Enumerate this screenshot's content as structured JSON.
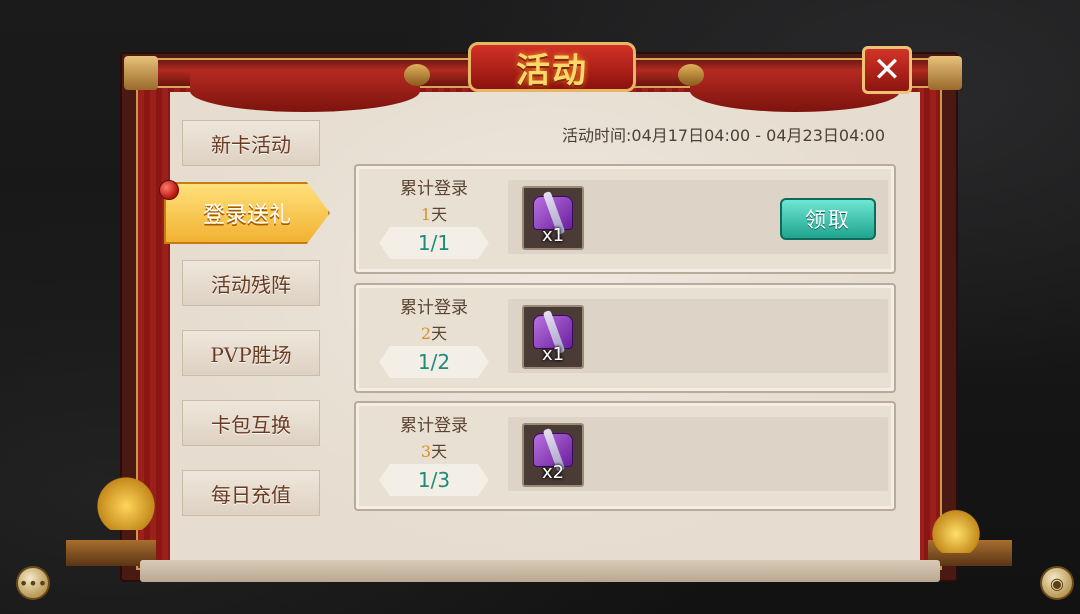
{
  "title": "活动",
  "close_label": "✕",
  "time_text": "活动时间:04月17日04:00 - 04月23日04:00",
  "tabs": [
    {
      "label": "新卡活动"
    },
    {
      "label": "登录送礼"
    },
    {
      "label": "活动残阵"
    },
    {
      "label": "PVP胜场"
    },
    {
      "label": "卡包互换"
    },
    {
      "label": "每日充值"
    }
  ],
  "active_tab": 1,
  "rows": [
    {
      "label": "累计登录",
      "day_num": "1",
      "day_unit": "天",
      "progress": "1/1",
      "item_qty": "x1",
      "button": "领取"
    },
    {
      "label": "累计登录",
      "day_num": "2",
      "day_unit": "天",
      "progress": "1/2",
      "item_qty": "x1"
    },
    {
      "label": "累计登录",
      "day_num": "3",
      "day_unit": "天",
      "progress": "1/3",
      "item_qty": "x2"
    }
  ],
  "icons": {
    "chat": "chat-bubble",
    "friends": "friends-group",
    "gift_box": "purple-gift-box",
    "notification_dot": "red-dot"
  },
  "colors": {
    "accent_gold": "#f2b233",
    "frame_red": "#9b1f1a",
    "progress_teal": "#1e8a7c",
    "claim_button": "#1fa58f",
    "day_orange": "#d9902a"
  }
}
